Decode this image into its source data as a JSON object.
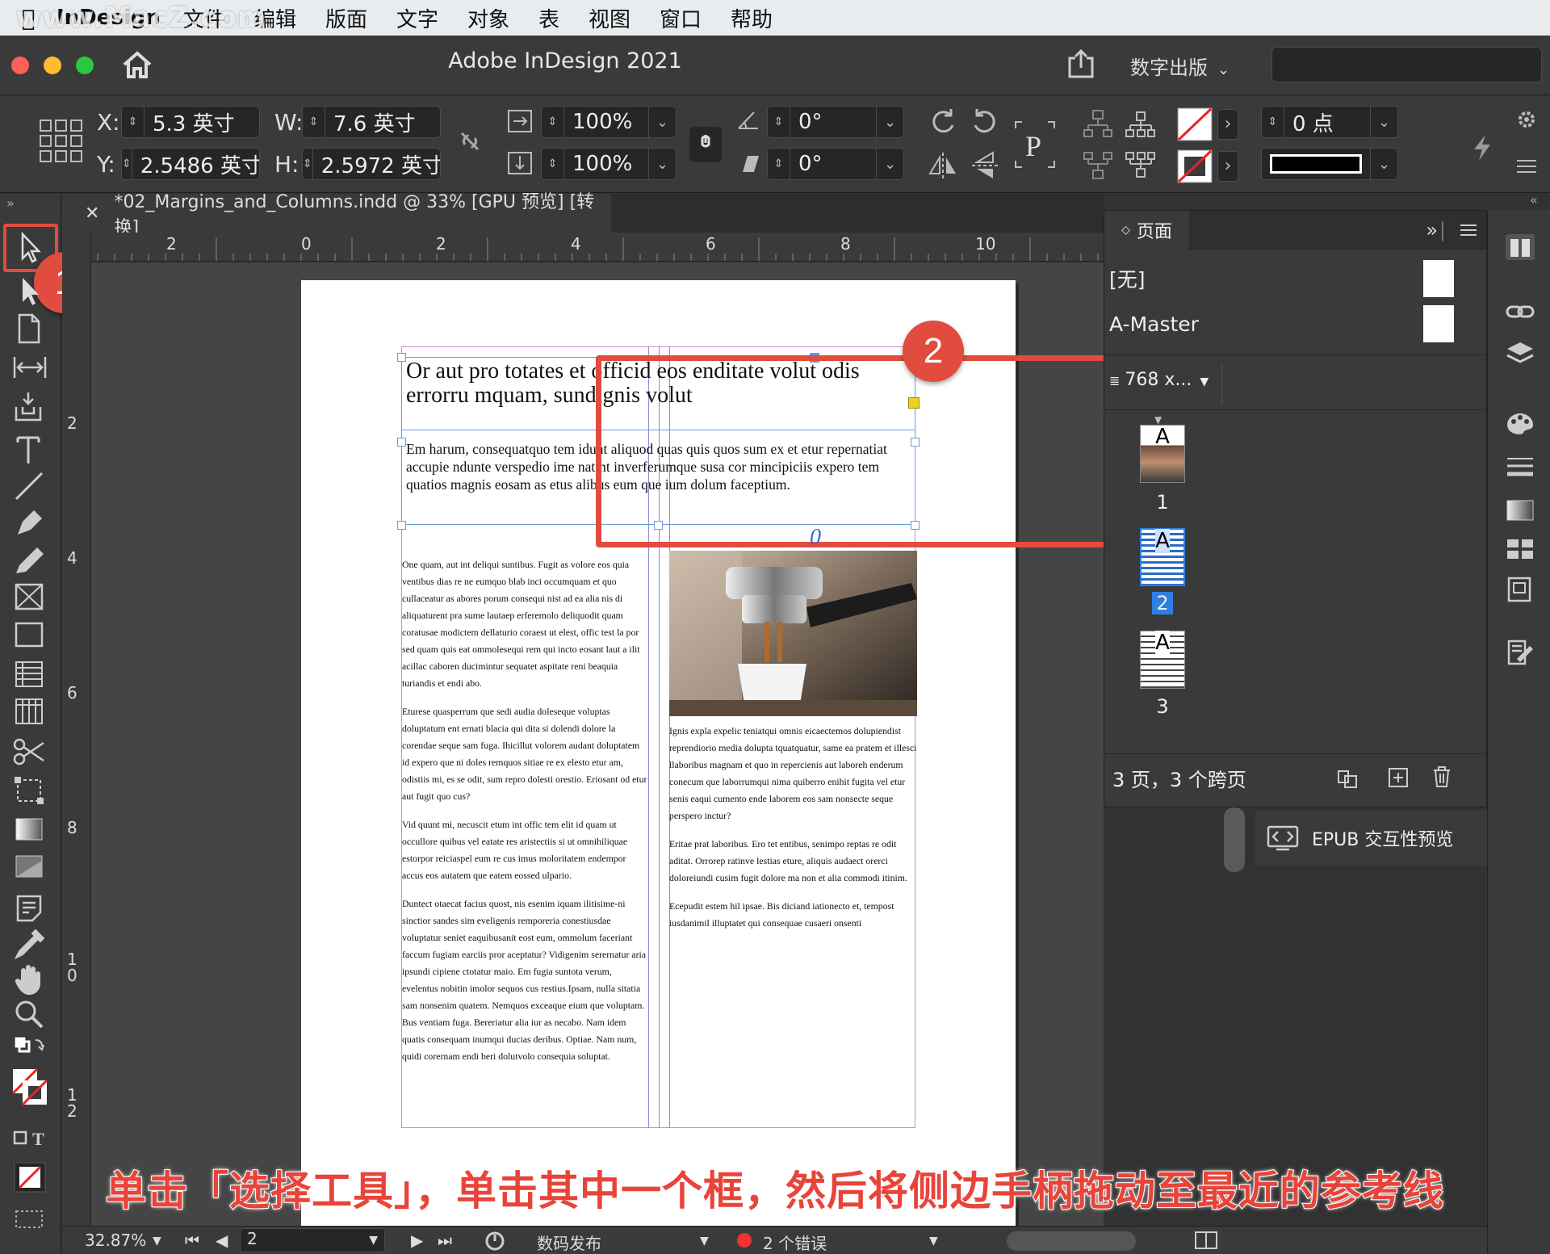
{
  "menubar": {
    "app_name": "InDesign",
    "items": [
      "文件",
      "编辑",
      "版面",
      "文字",
      "对象",
      "表",
      "视图",
      "窗口",
      "帮助"
    ],
    "watermark": "www.MacZ.com"
  },
  "titlebar": {
    "title": "Adobe InDesign 2021",
    "workspace": "数字出版"
  },
  "control": {
    "x_label": "X:",
    "x_value": "5.3 英寸",
    "y_label": "Y:",
    "y_value": "2.5486 英寸",
    "w_label": "W:",
    "w_value": "7.6 英寸",
    "h_label": "H:",
    "h_value": "2.5972 英寸",
    "scale_x": "100%",
    "scale_y": "100%",
    "rotate": "0°",
    "shear": "0°",
    "stroke_weight": "0 点"
  },
  "document": {
    "tab_title": "*02_Margins_and_Columns.indd @ 33% [GPU 预览] [转换]",
    "ruler_h": [
      "2",
      "0",
      "2",
      "4",
      "6",
      "8",
      "10"
    ],
    "ruler_v": [
      "2",
      "4",
      "6",
      "8",
      "1 0",
      "1 2"
    ],
    "headline": "Or aut pro totates et officid eos enditate volut odis errorru mquam, sundignis volut",
    "deck": "Em harum, consequatquo tem idunt aliquod quas quis quos sum ex et etur repernatiat accupie ndunte verspedio ime natint inverferumque susa cor mincipiciis expero tem quatios magnis eosam as etus alibus eum que ium dolum faceptium.",
    "col1": [
      "One quam, aut int deliqui suntibus. Fugit as volore eos quia ventibus dias re ne eumquo blab inci occumquam et quo cullaceatur as abores porum consequi nist ad ea alia nis di aliquaturent pra sume lautaep erferemolo deliquodit quam coratusae modictem dellaturio coraest ut elest, offic test la por sed quam quis eat ommolesequi rem qui incto eosant laut a ilit acillac caboren ducimintur sequatet aspitate reni beaquia turiandis et endi abo.",
      "Eturese quasperrum que sedi audia doleseque voluptas doluptatum ent ernati blacia qui dita si dolendi dolore la corendae seque sam fuga. Ihicillut volorem audant doluptatem id expero que ni doles remquos sitiae re ex elesto etur am, odistiis mi, es se odit, sum repro dolesti orestio. Eriosant od etur aut fugit quo cus?",
      "Vid quunt mi, necuscit etum int offic tem elit id quam ut occullore quibus vel eatate res aristectiis si ut omnihiliquae estorpor reiciaspel eum re cus imus moloritatem endempor accus eos autatem que eatem eossed ulpario.",
      "Duntect otaecat facius quost, nis esenim iquam ilitisime-ni sinctior sandes sim eveligenis remporeria conestiusdae voluptatur seniet eaquibusanit eost eum, ommolum faceriant faccum fugiam earciis pror aceptatur? Vidigenim serernatur aria ipsundi cipiene ctotatur maio. Em fugia suntota verum, evelentus nobitin imolor sequos cus restius.Ipsam, nulla sitatia sam nonsenim quatem. Nemquos exceaque eium que voluptam. Bus ventiam fuga. Bereriatur alia iur as necabo. Nam idem quatis consequam inumqui ducias deribus. Optiae. Nam num, quidi corernam endi beri dolutvolo consequia soluptat."
    ],
    "col2": [
      "Ignis expla expelic teniatqui omnis eicaectemos dolupiendist reprendiorio media dolupta tquatquatur, same ea pratem et illesci llaboribus magnam et quo in repercienis aut laboreh enderum conecum que laborrumqui nima quiberro enihit fugita vel etur senis eaqui cumento ende laborem eos sam nonsecte seque perspero inctur?",
      "Eritae prat laboribus. Ero tet entibus, senimpo reptas re odit aditat. Orrorep ratinve lestias eture, aliquis audaect orerci doloreiundi cusim fugit dolore ma non et alia commodi itinim.",
      "Ecepudit estem hil ipsae. Bis diciand iationecto et, tempost iusdanimil illuptatet qui consequae cusaeri onsenti"
    ],
    "overset_marker": "0"
  },
  "pages_panel": {
    "tab_label": "页面",
    "none_master": "[无]",
    "a_master": "A-Master",
    "page_size": "768 x...",
    "thumb_marker": "A",
    "pages": [
      "1",
      "2",
      "3"
    ],
    "selected_page": "2",
    "footer": "3 页，3 个跨页"
  },
  "epub_label": "EPUB 交互性预览",
  "statusbar": {
    "zoom": "32.87%",
    "page": "2",
    "profile": "数码发布",
    "errors": "2 个错误"
  },
  "badges": {
    "one": "1",
    "two": "2"
  },
  "caption": "单击「选择工具」，单击其中一个框，然后将侧边手柄拖动至最近的参考线",
  "colors": {
    "highlight": "#e24c3f",
    "page_selected": "#2d7fe0",
    "error": "#e33333"
  }
}
